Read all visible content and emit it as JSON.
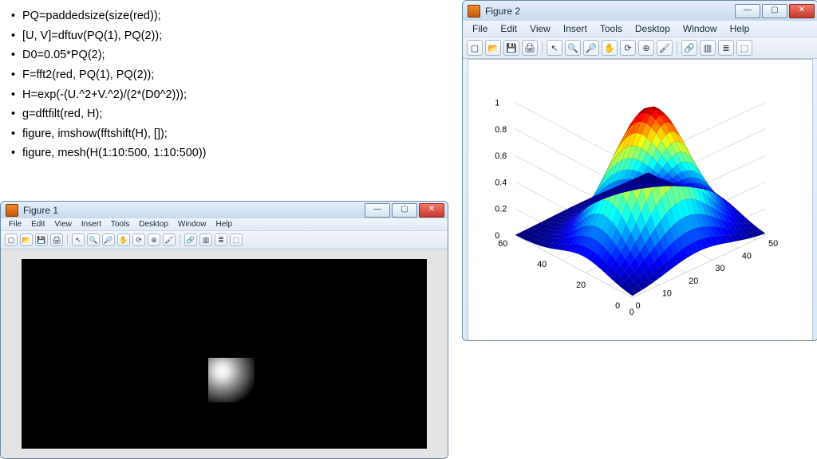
{
  "code": [
    "PQ=paddedsize(size(red));",
    "[U, V]=dftuv(PQ(1), PQ(2));",
    "D0=0.05*PQ(2);",
    "F=fft2(red, PQ(1), PQ(2));",
    "H=exp(-(U.^2+V.^2)/(2*(D0^2)));",
    "g=dftfilt(red, H);",
    "figure, imshow(fftshift(H), []);",
    "figure, mesh(H(1:10:500, 1:10:500))"
  ],
  "figure1": {
    "title": "Figure 1",
    "menu": [
      "File",
      "Edit",
      "View",
      "Insert",
      "Tools",
      "Desktop",
      "Window",
      "Help"
    ]
  },
  "figure2": {
    "title": "Figure 2",
    "menu": [
      "File",
      "Edit",
      "View",
      "Insert",
      "Tools",
      "Desktop",
      "Window",
      "Help"
    ]
  },
  "winbuttons": {
    "min": "—",
    "max": "▢",
    "close": "✕"
  },
  "toolbar_icons": [
    "new-file-icon",
    "open-file-icon",
    "save-icon",
    "print-icon",
    "pointer-icon",
    "zoom-in-icon",
    "zoom-out-icon",
    "pan-icon",
    "rotate-icon",
    "data-cursor-icon",
    "brush-icon",
    "link-icon",
    "colorbar-icon",
    "legend-icon",
    "dock-icon"
  ],
  "toolbar_glyphs": [
    "▢",
    "📂",
    "💾",
    "🖨",
    "↖",
    "🔍",
    "🔎",
    "✋",
    "⟳",
    "⊕",
    "🖌",
    "🔗",
    "▥",
    "≣",
    "⬚"
  ],
  "chart_data": {
    "type": "surface",
    "title": "",
    "xlabel": "",
    "ylabel": "",
    "zlabel": "",
    "x_range": [
      0,
      50
    ],
    "y_range": [
      0,
      60
    ],
    "z_range": [
      0,
      1
    ],
    "x_ticks": [
      0,
      10,
      20,
      30,
      40,
      50
    ],
    "y_ticks": [
      0,
      20,
      40,
      60
    ],
    "z_ticks": [
      0,
      0.2,
      0.4,
      0.6,
      0.8,
      1
    ],
    "description": "Gaussian surface H = exp(-(U^2+V^2)/(2*D0^2)) sampled on a 50x50 grid; peak ≈1 near (25,25), decaying to ≈0 at edges",
    "peak": {
      "x": 25,
      "y": 25,
      "z": 1.0
    },
    "sigma_approx": 12
  }
}
